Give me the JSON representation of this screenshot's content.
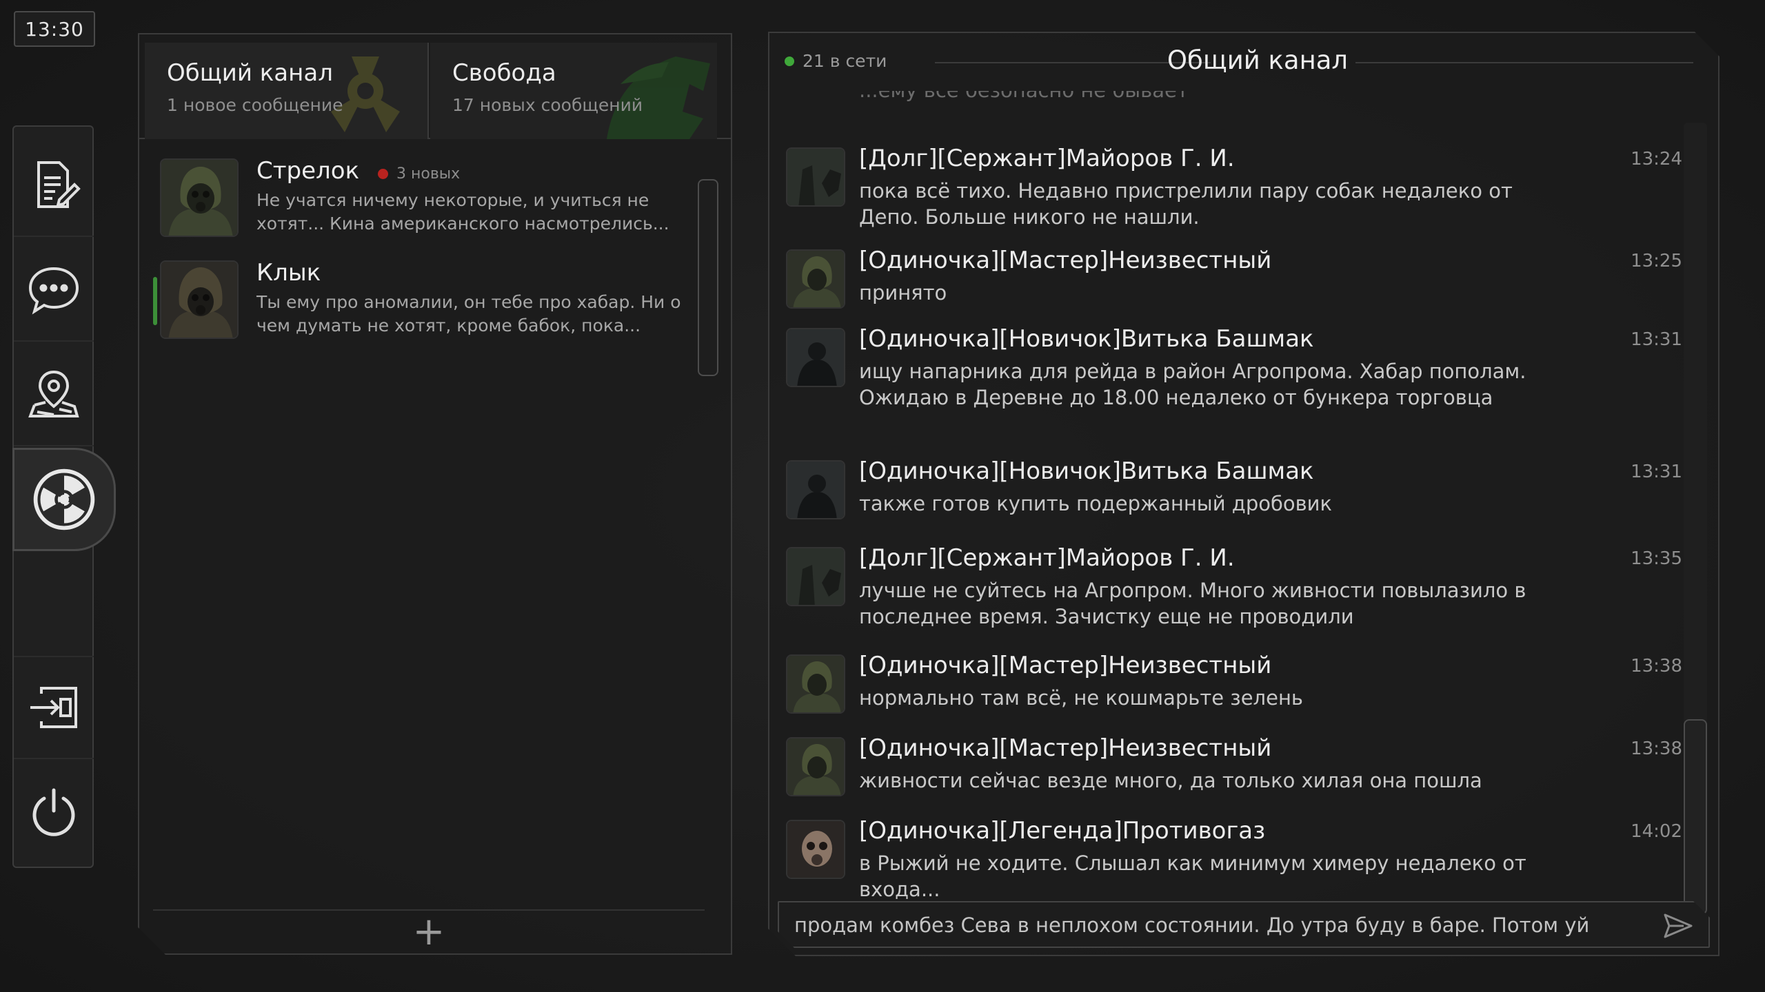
{
  "clock": "13:30",
  "sidebar": {
    "items": [
      {
        "icon": "notes-edit-icon"
      },
      {
        "icon": "chat-bubble-icon"
      },
      {
        "icon": "map-pin-icon"
      },
      {
        "icon": "radiation-icon"
      },
      {
        "icon": "exit-login-icon"
      },
      {
        "icon": "power-icon"
      }
    ]
  },
  "tabs": [
    {
      "name": "Общий канал",
      "sub": "1 новое сообщение"
    },
    {
      "name": "Свобода",
      "sub": "17 новых сообщений"
    }
  ],
  "chats": [
    {
      "name": "Стрелок",
      "badge": "3 новых",
      "preview": "Не учатся ничему некоторые, и учиться не хотят... Кина американского насмотрелись..."
    },
    {
      "name": "Клык",
      "badge": "",
      "preview": "Ты ему про аномалии, он тебе про хабар. Ни о чем думать не хотят, кроме бабок, пока..."
    }
  ],
  "add_label": "+",
  "conversation": {
    "online": "21 в сети",
    "title": "Общий канал",
    "ghost": "...ему все безопасно не бывает",
    "messages": [
      {
        "author": "[Долг][Сержант]Майоров Г. И.",
        "time": "13:24",
        "text": "пока всё тихо. Недавно пристрелили пару собак недалеко от Депо. Больше никого не нашли."
      },
      {
        "author": "[Одиночка][Мастер]Неизвестный",
        "time": "13:25",
        "text": "принято"
      },
      {
        "author": "[Одиночка][Новичок]Витька Башмак",
        "time": "13:31",
        "text": "ищу напарника для рейда в район Агропрома. Хабар пополам. Ожидаю в Деревне до 18.00 недалеко от бункера торговца"
      },
      {
        "author": "[Одиночка][Новичок]Витька Башмак",
        "time": "13:31",
        "text": "также готов купить подержанный дробовик"
      },
      {
        "author": "[Долг][Сержант]Майоров Г. И.",
        "time": "13:35",
        "text": "лучше не суйтесь на Агропром. Много живности повылазило в последнее время. Зачистку еще не проводили"
      },
      {
        "author": "[Одиночка][Мастер]Неизвестный",
        "time": "13:38",
        "text": "нормально там всё, не кошмарьте зелень"
      },
      {
        "author": "[Одиночка][Мастер]Неизвестный",
        "time": "13:38",
        "text": "живности сейчас везде много, да только хилая она пошла"
      },
      {
        "author": "[Одиночка][Легенда]Противогаз",
        "time": "14:02",
        "text": "в Рыжий не ходите. Слышал как минимум химеру недалеко от входа..."
      }
    ],
    "input_value": "продам комбез Сева в неплохом состоянии. До утра буду в баре. Потом уй"
  },
  "colors": {
    "online": "#3fa83a",
    "unread": "#b8231f",
    "accent_green": "#3c8f38"
  }
}
